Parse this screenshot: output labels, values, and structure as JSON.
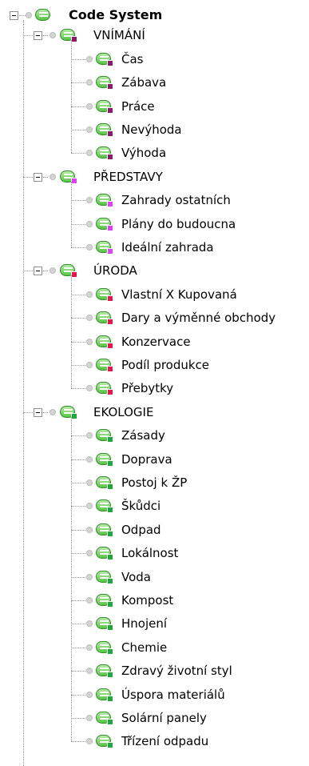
{
  "tree": {
    "root": {
      "label": "Code System"
    },
    "groups": [
      {
        "label": "VNÍMÁNÍ",
        "color": "#8b1a6b",
        "items": [
          "Čas",
          "Zábava",
          "Práce",
          "Nevýhoda",
          "Výhoda"
        ]
      },
      {
        "label": "PŘEDSTAVY",
        "color": "#e040fb",
        "items": [
          "Zahrady ostatních",
          "Plány do budoucna",
          "Ideální zahrada"
        ]
      },
      {
        "label": "ÚRODA",
        "color": "#e8174a",
        "items": [
          "Vlastní X Kupovaná",
          "Dary a výměnné obchody",
          "Konzervace",
          "Podíl produkce",
          "Přebytky"
        ]
      },
      {
        "label": "EKOLOGIE",
        "color": "#1fa83a",
        "items": [
          "Zásady",
          "Doprava",
          "Postoj k ŽP",
          "Škůdci",
          "Odpad",
          "Lokálnost",
          "Voda",
          "Kompost",
          "Hnojení",
          "Chemie",
          "Zdravý životní styl",
          "Úspora materiálů",
          "Solární panely",
          "Třízení odpadu"
        ]
      }
    ]
  }
}
